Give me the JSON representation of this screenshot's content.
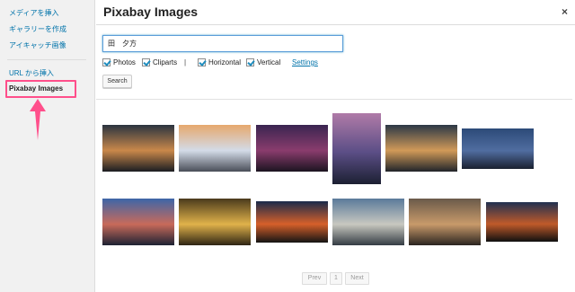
{
  "sidebar": {
    "items": [
      {
        "label": "メディアを挿入"
      },
      {
        "label": "ギャラリーを作成"
      },
      {
        "label": "アイキャッチ画像"
      },
      {
        "label": "URL から挿入"
      }
    ],
    "active_label": "Pixabay Images"
  },
  "header": {
    "title": "Pixabay Images",
    "close_symbol": "×"
  },
  "search": {
    "value": "田　夕方"
  },
  "filters": {
    "photos": "Photos",
    "cliparts": "Cliparts",
    "horizontal": "Horizontal",
    "vertical": "Vertical",
    "separator": "|",
    "settings": "Settings"
  },
  "search_button": "Search",
  "results": {
    "thumbnails": [
      {
        "name": "night-street-thumbnail",
        "colors": [
          "#2a3440",
          "#c9884a",
          "#1a1d22"
        ]
      },
      {
        "name": "theater-thumbnail",
        "colors": [
          "#e6a86d",
          "#d3dbe8",
          "#4a4e58"
        ]
      },
      {
        "name": "purple-dusk-thumbnail",
        "colors": [
          "#3a2550",
          "#8a3c6d",
          "#1c1420"
        ]
      },
      {
        "name": "tower-thumbnail",
        "colors": [
          "#b07ba8",
          "#5b4e86",
          "#1c2032"
        ]
      },
      {
        "name": "alley-thumbnail",
        "colors": [
          "#2b3846",
          "#d19a58",
          "#20242a"
        ]
      },
      {
        "name": "city-lights-thumbnail",
        "colors": [
          "#2c4a78",
          "#506da0",
          "#1a2030"
        ]
      },
      {
        "name": "skyline-sunset-thumbnail",
        "colors": [
          "#3d66a8",
          "#c86a5a",
          "#1d2233"
        ]
      },
      {
        "name": "golden-lake-thumbnail",
        "colors": [
          "#4a3a1c",
          "#e0b24a",
          "#2e2414"
        ]
      },
      {
        "name": "orange-horizon-thumbnail",
        "colors": [
          "#1a2a4a",
          "#d6602a",
          "#141414"
        ]
      },
      {
        "name": "bridge-clouds-thumbnail",
        "colors": [
          "#5a7a9a",
          "#c8c8c0",
          "#343c44"
        ]
      },
      {
        "name": "ballerina-thumbnail",
        "colors": [
          "#6a5a4a",
          "#c89a6a",
          "#2a2420"
        ]
      },
      {
        "name": "streetlamp-thumbnail",
        "colors": [
          "#203050",
          "#c05a2a",
          "#101010"
        ]
      }
    ]
  },
  "pagination": {
    "prev": "Prev",
    "page": "1",
    "next": "Next"
  },
  "colors": {
    "link": "#0073aa",
    "highlight": "#ff4f8b",
    "checkbox": "#1e8cbe"
  }
}
